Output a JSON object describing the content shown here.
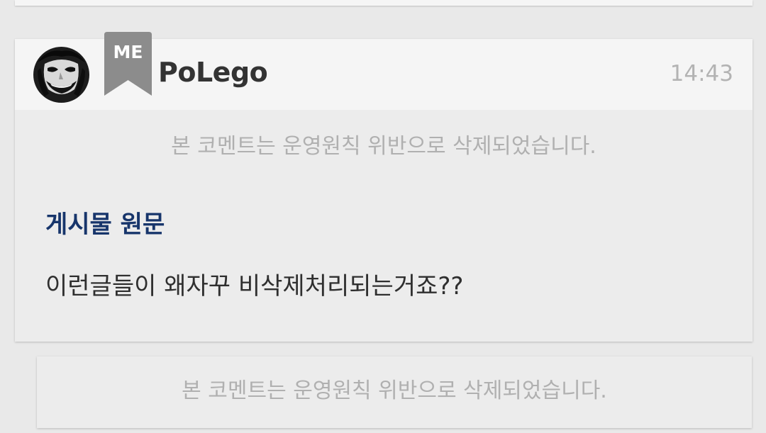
{
  "comment": {
    "username": "PoLego",
    "badge_label": "ME",
    "timestamp": "14:43",
    "deleted_notice": "본 코멘트는 운영원칙 위반으로 삭제되었습니다.",
    "original_label": "게시물 원문",
    "original_text": "이런글들이 왜자꾸 비삭제처리되는거죠??"
  },
  "reply": {
    "deleted_notice": "본 코멘트는 운영원칙 위반으로 삭제되었습니다."
  },
  "colors": {
    "page_background": "#e9e9e9",
    "card_header_background": "#f5f5f5",
    "card_body_background": "#ececec",
    "badge": "#8c8c8c",
    "username": "#333333",
    "timestamp": "#b3b3b3",
    "deleted_notice": "#b0b0b0",
    "original_label": "#17356b",
    "original_text": "#2f2f2f"
  },
  "icons": {
    "avatar": "joker-face-avatar",
    "badge": "bookmark-ribbon-icon"
  }
}
